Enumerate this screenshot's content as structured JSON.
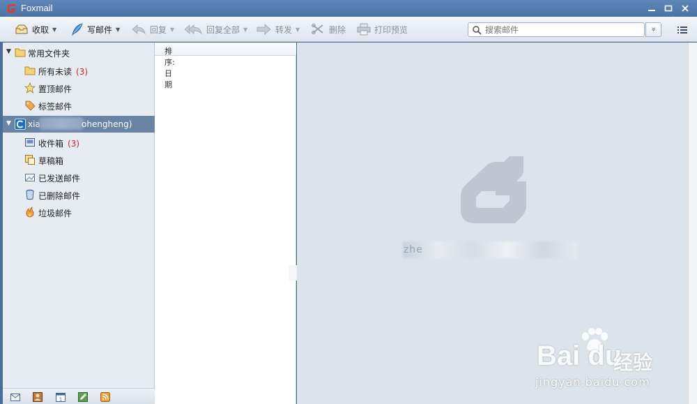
{
  "window": {
    "title": "Foxmail"
  },
  "toolbar": {
    "receive": "收取",
    "compose": "写邮件",
    "reply": "回复",
    "reply_all": "回复全部",
    "forward": "转发",
    "delete": "删除",
    "print_preview": "打印预览"
  },
  "search": {
    "placeholder": "搜索邮件",
    "options_glyph": "»"
  },
  "sidebar": {
    "common_group": "常用文件夹",
    "common_items": [
      {
        "label": "所有未读",
        "count": "(3)"
      },
      {
        "label": "置顶邮件",
        "count": ""
      },
      {
        "label": "标签邮件",
        "count": ""
      }
    ],
    "account": {
      "prefix": "xia",
      "suffix": "ohengheng)"
    },
    "account_items": [
      {
        "label": "收件箱",
        "count": "(3)"
      },
      {
        "label": "草稿箱",
        "count": ""
      },
      {
        "label": "已发送邮件",
        "count": ""
      },
      {
        "label": "已删除邮件",
        "count": ""
      },
      {
        "label": "垃圾邮件",
        "count": ""
      }
    ]
  },
  "maillist": {
    "sort_label": "排序:日期"
  },
  "reading": {
    "redacted_text": "zhe"
  },
  "watermark": {
    "brand": "Bai du",
    "cn": "经验",
    "url": "jingyan.baidu.com"
  },
  "colors": {
    "accent": "#4b73a6",
    "selected": "#6a84a5",
    "count": "#d4232a"
  }
}
